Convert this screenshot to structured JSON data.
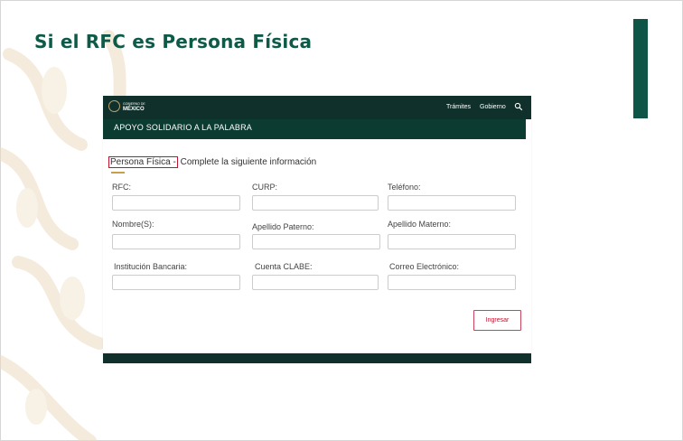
{
  "slide": {
    "title": "Si el RFC es Persona Física",
    "colors": {
      "title": "#0e5a48",
      "accent_bar": "#0d5547",
      "ornament": "#ecdcc1"
    }
  },
  "site": {
    "logo_small": "GOBIERNO DE",
    "logo_main": "MÉXICO",
    "nav": {
      "tramites": "Trámites",
      "gobierno": "Gobierno",
      "search_icon": "search-icon"
    },
    "banner": "APOYO SOLIDARIO A LA PALABRA",
    "colors": {
      "nav": "#10312b",
      "banner": "#0c3b32",
      "underline": "#c8a04a",
      "button": "#c4122f"
    }
  },
  "form": {
    "heading_highlight": "Persona Física -",
    "heading_rest": " Complete la siguiente información",
    "fields": {
      "rfc": "RFC:",
      "curp": "CURP:",
      "telefono": "Teléfono:",
      "nombre": "Nombre(S):",
      "apellido_paterno": "Apellido Paterno:",
      "apellido_materno": "Apellido Materno:",
      "institucion_bancaria": "Institución Bancaria:",
      "cuenta_clabe": "Cuenta CLABE:",
      "correo": "Correo Electrónico:"
    },
    "submit": "Ingresar"
  }
}
